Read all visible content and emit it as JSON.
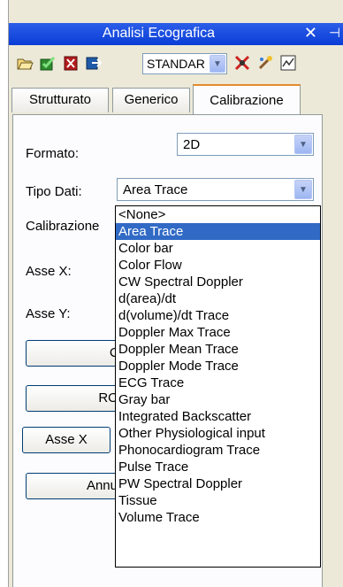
{
  "window": {
    "title": "Analisi Ecografica",
    "close_glyph": "✕",
    "pin_glyph": "⊣"
  },
  "toolbar": {
    "icons": [
      "open-icon",
      "ok-check-icon",
      "delete-icon",
      "export-icon",
      "tools-icon",
      "wizard-icon",
      "chart-icon"
    ],
    "preset": "STANDAR"
  },
  "tabs": [
    {
      "label": "Strutturato",
      "active": false
    },
    {
      "label": "Generico",
      "active": false
    },
    {
      "label": "Calibrazione",
      "active": true
    }
  ],
  "form": {
    "formato_label": "Formato:",
    "formato_value": "2D",
    "tipo_dati_label": "Tipo Dati:",
    "tipo_dati_value": "Area Trace",
    "calibrazione_label": "Calibrazione",
    "asse_x_label": "Asse X:",
    "asse_y_label": "Asse Y:"
  },
  "buttons": {
    "car": "Car",
    "roi": "ROI",
    "asse_x": "Asse X",
    "annulla": "Annulla"
  },
  "dropdown": {
    "selected": "Area Trace",
    "items": [
      "<None>",
      "Area Trace",
      "Color bar",
      "Color Flow",
      "CW Spectral Doppler",
      "d(area)/dt",
      "d(volume)/dt Trace",
      "Doppler Max Trace",
      "Doppler Mean Trace",
      "Doppler Mode Trace",
      "ECG Trace",
      "Gray bar",
      "Integrated Backscatter",
      "Other Physiological input",
      "Phonocardiogram Trace",
      "Pulse Trace",
      "PW Spectral Doppler",
      "Tissue",
      "Volume Trace"
    ]
  },
  "colors": {
    "title_bar": "#0a3dd6",
    "selection": "#316ac5",
    "tab_accent": "#e68b2c"
  }
}
